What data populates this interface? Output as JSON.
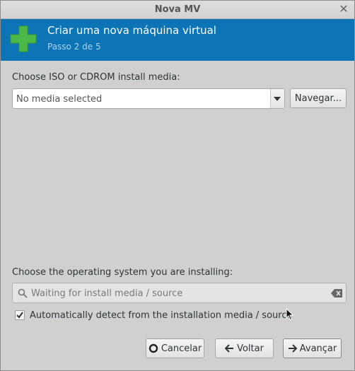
{
  "window": {
    "title": "Nova MV"
  },
  "banner": {
    "heading": "Criar uma nova máquina virtual",
    "step": "Passo 2 de 5"
  },
  "media": {
    "label": "Choose ISO or CDROM install media:",
    "combo_value": "No media selected",
    "browse_label": "Navegar..."
  },
  "os": {
    "label": "Choose the operating system you are installing:",
    "search_text": "Waiting for install media / source",
    "autodetect_label": "Automatically detect from the installation media / source",
    "autodetect_checked": true
  },
  "footer": {
    "cancel_label": "Cancelar",
    "back_label": "Voltar",
    "forward_label": "Avançar"
  },
  "colors": {
    "banner": "#0d74b6",
    "plus": "#4cb848"
  }
}
